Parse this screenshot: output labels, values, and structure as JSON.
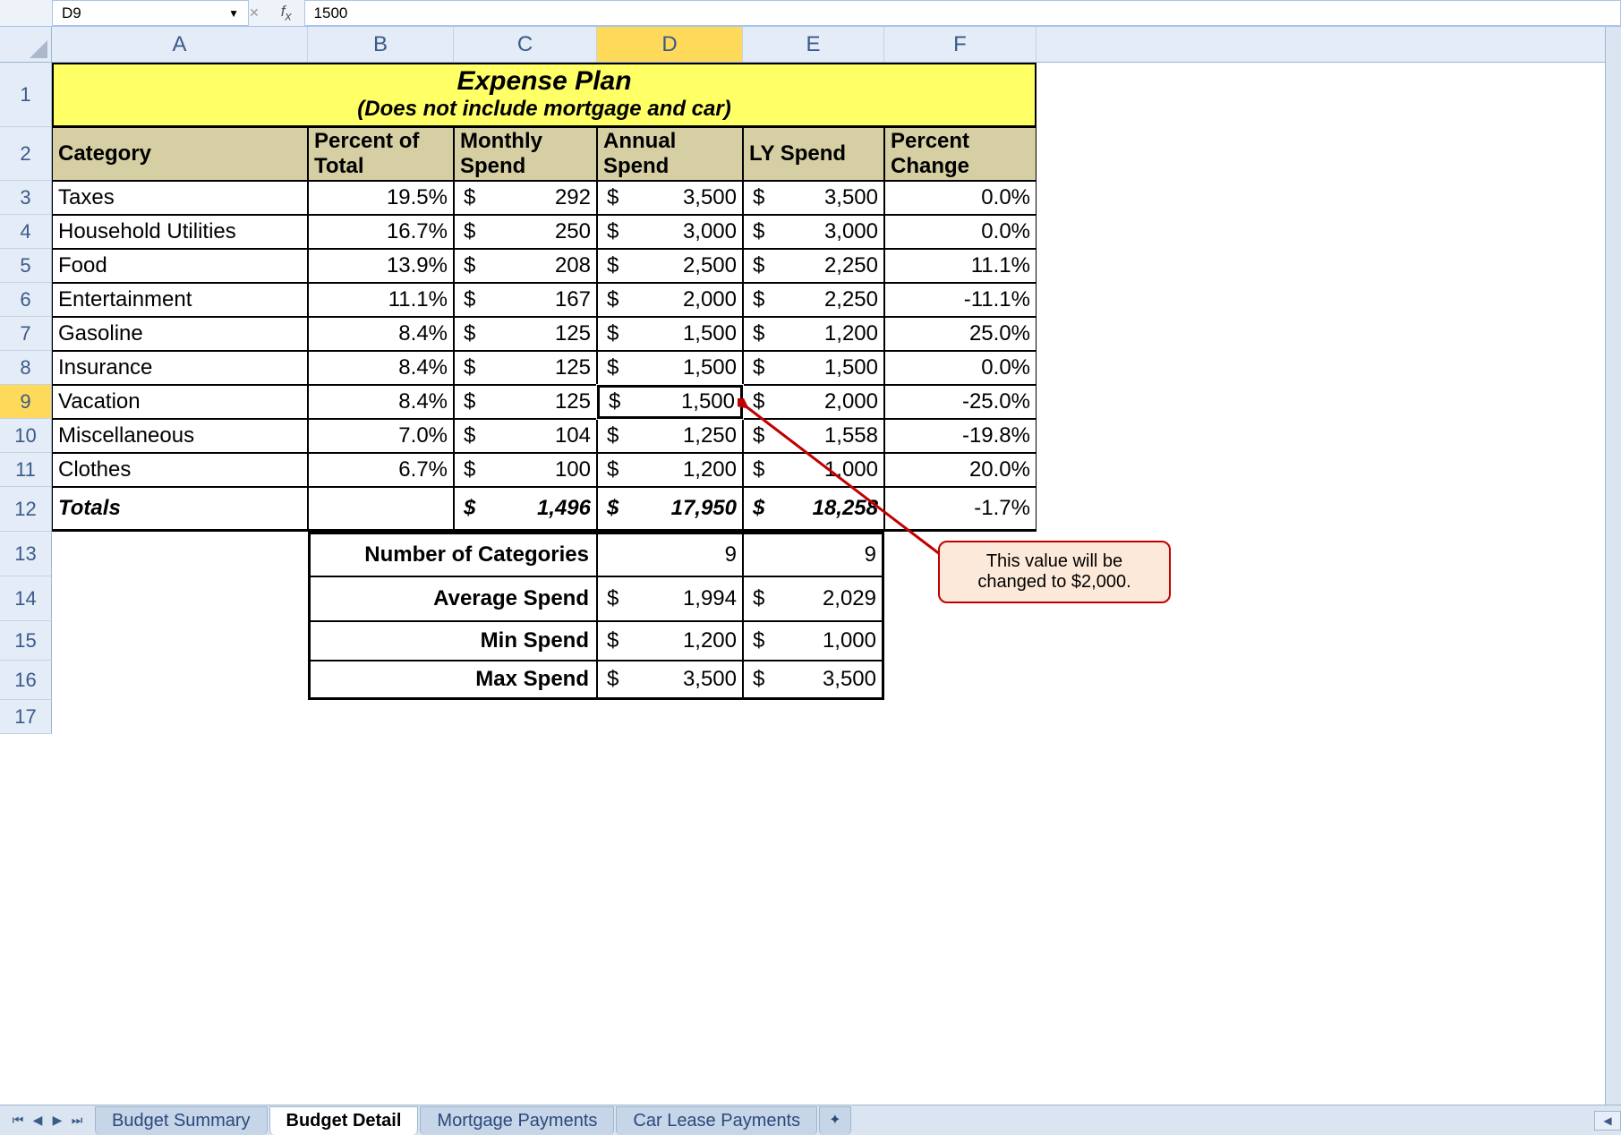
{
  "nameBox": "D9",
  "formulaValue": "1500",
  "columns": [
    "A",
    "B",
    "C",
    "D",
    "E",
    "F"
  ],
  "activeColumn": "D",
  "activeRow": 9,
  "title": {
    "line1": "Expense Plan",
    "line2": "(Does not include mortgage and car)"
  },
  "headers": {
    "A": "Category",
    "B": "Percent of Total",
    "C": "Monthly Spend",
    "D": "Annual Spend",
    "E": "LY Spend",
    "F": "Percent Change"
  },
  "rows": [
    {
      "r": 3,
      "cat": "Taxes",
      "pct": "19.5%",
      "mon": "292",
      "ann": "3,500",
      "ly": "3,500",
      "chg": "0.0%"
    },
    {
      "r": 4,
      "cat": "Household Utilities",
      "pct": "16.7%",
      "mon": "250",
      "ann": "3,000",
      "ly": "3,000",
      "chg": "0.0%"
    },
    {
      "r": 5,
      "cat": "Food",
      "pct": "13.9%",
      "mon": "208",
      "ann": "2,500",
      "ly": "2,250",
      "chg": "11.1%"
    },
    {
      "r": 6,
      "cat": "Entertainment",
      "pct": "11.1%",
      "mon": "167",
      "ann": "2,000",
      "ly": "2,250",
      "chg": "-11.1%"
    },
    {
      "r": 7,
      "cat": "Gasoline",
      "pct": "8.4%",
      "mon": "125",
      "ann": "1,500",
      "ly": "1,200",
      "chg": "25.0%"
    },
    {
      "r": 8,
      "cat": "Insurance",
      "pct": "8.4%",
      "mon": "125",
      "ann": "1,500",
      "ly": "1,500",
      "chg": "0.0%"
    },
    {
      "r": 9,
      "cat": "Vacation",
      "pct": "8.4%",
      "mon": "125",
      "ann": "1,500",
      "ly": "2,000",
      "chg": "-25.0%"
    },
    {
      "r": 10,
      "cat": "Miscellaneous",
      "pct": "7.0%",
      "mon": "104",
      "ann": "1,250",
      "ly": "1,558",
      "chg": "-19.8%"
    },
    {
      "r": 11,
      "cat": "Clothes",
      "pct": "6.7%",
      "mon": "100",
      "ann": "1,200",
      "ly": "1,000",
      "chg": "20.0%"
    }
  ],
  "totals": {
    "r": 12,
    "label": "Totals",
    "mon": "1,496",
    "ann": "17,950",
    "ly": "18,258",
    "chg": "-1.7%"
  },
  "stats": [
    {
      "r": 13,
      "label": "Number of Categories",
      "d": "9",
      "e": "9",
      "money": false
    },
    {
      "r": 14,
      "label": "Average Spend",
      "d": "1,994",
      "e": "2,029",
      "money": true
    },
    {
      "r": 15,
      "label": "Min Spend",
      "d": "1,200",
      "e": "1,000",
      "money": true
    },
    {
      "r": 16,
      "label": "Max Spend",
      "d": "3,500",
      "e": "3,500",
      "money": true
    }
  ],
  "rowNumbers": [
    1,
    2,
    3,
    4,
    5,
    6,
    7,
    8,
    9,
    10,
    11,
    12,
    13,
    14,
    15,
    16,
    17
  ],
  "rowHeights": {
    "1": 72,
    "2": 60,
    "3": 38,
    "4": 38,
    "5": 38,
    "6": 38,
    "7": 38,
    "8": 38,
    "9": 38,
    "10": 38,
    "11": 38,
    "12": 50,
    "13": 50,
    "14": 50,
    "15": 44,
    "16": 44,
    "17": 38
  },
  "annotation": "This value will be changed to $2,000.",
  "tabs": [
    "Budget Summary",
    "Budget Detail",
    "Mortgage Payments",
    "Car Lease Payments"
  ],
  "activeTab": "Budget Detail",
  "dollarSign": "$"
}
